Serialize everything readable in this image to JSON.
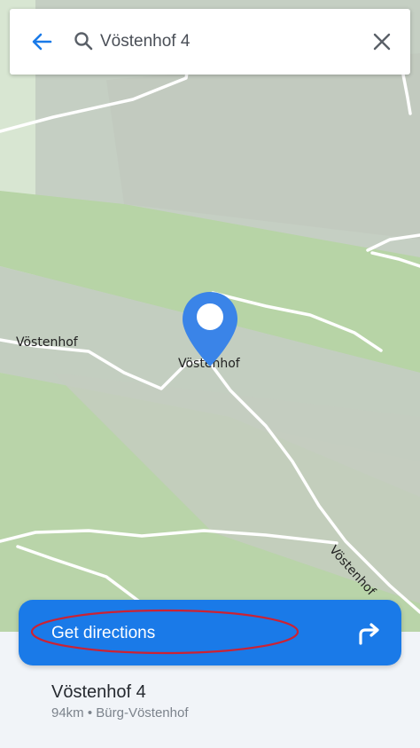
{
  "search": {
    "query": "Vöstenhof 4",
    "back_icon": "back-arrow-icon",
    "search_icon": "search-icon",
    "close_icon": "close-icon"
  },
  "map": {
    "labels": {
      "left_road": "Vöstenhof",
      "pin_label": "Vöstenhof",
      "lower_road": "Vöstenhof"
    },
    "pin_color": "#3a84e8"
  },
  "actions": {
    "directions_label": "Get directions",
    "directions_icon": "turn-right-arrow-icon",
    "accent": "#1a7ae8",
    "highlight_color": "#cc2233"
  },
  "place": {
    "title": "Vöstenhof 4",
    "subtitle": "94km • Bürg-Vöstenhof"
  }
}
